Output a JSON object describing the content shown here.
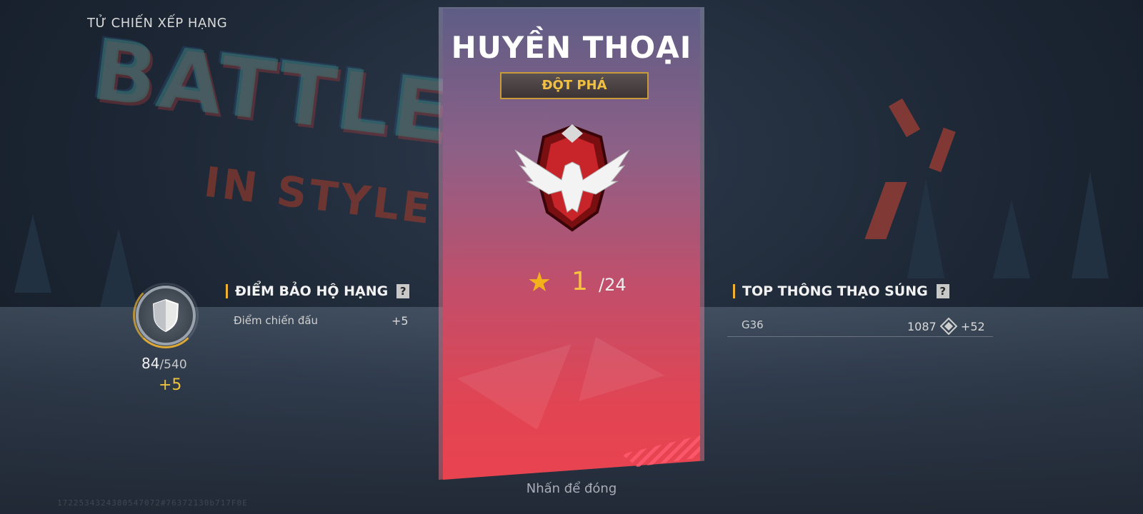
{
  "header": {
    "mode_title": "TỬ CHIẾN XẾP HẠNG"
  },
  "background_text": {
    "line1": "BATTLE",
    "line2": "IN STYLE"
  },
  "protection": {
    "title": "ĐIỂM BẢO HỘ HẠNG",
    "help": "?",
    "rows": [
      {
        "label": "Điểm chiến đấu",
        "value": "+5"
      }
    ],
    "score": "84",
    "max": "/540",
    "gain": "+5",
    "progress": 0.156
  },
  "rank_card": {
    "title": "HUYỀN THOẠI",
    "badge": "ĐỘT PHÁ",
    "stars": "1",
    "stars_total": "/24"
  },
  "weapon_mastery": {
    "title": "TOP THÔNG THẠO SÚNG",
    "help": "?",
    "weapon": "G36",
    "points": "1087",
    "gain": "+52"
  },
  "close_hint": "Nhấn để đóng",
  "uid_watermark": "1722534324380547072#76372130b717F0E",
  "colors": {
    "accent_gold": "#f0c23a",
    "card_top": "#5e5d86",
    "card_bottom": "#e94350",
    "star": "#f3b21c"
  },
  "icons": [
    "shield-icon",
    "star-icon",
    "eagle-emblem-icon",
    "mastery-icon",
    "help-icon"
  ]
}
